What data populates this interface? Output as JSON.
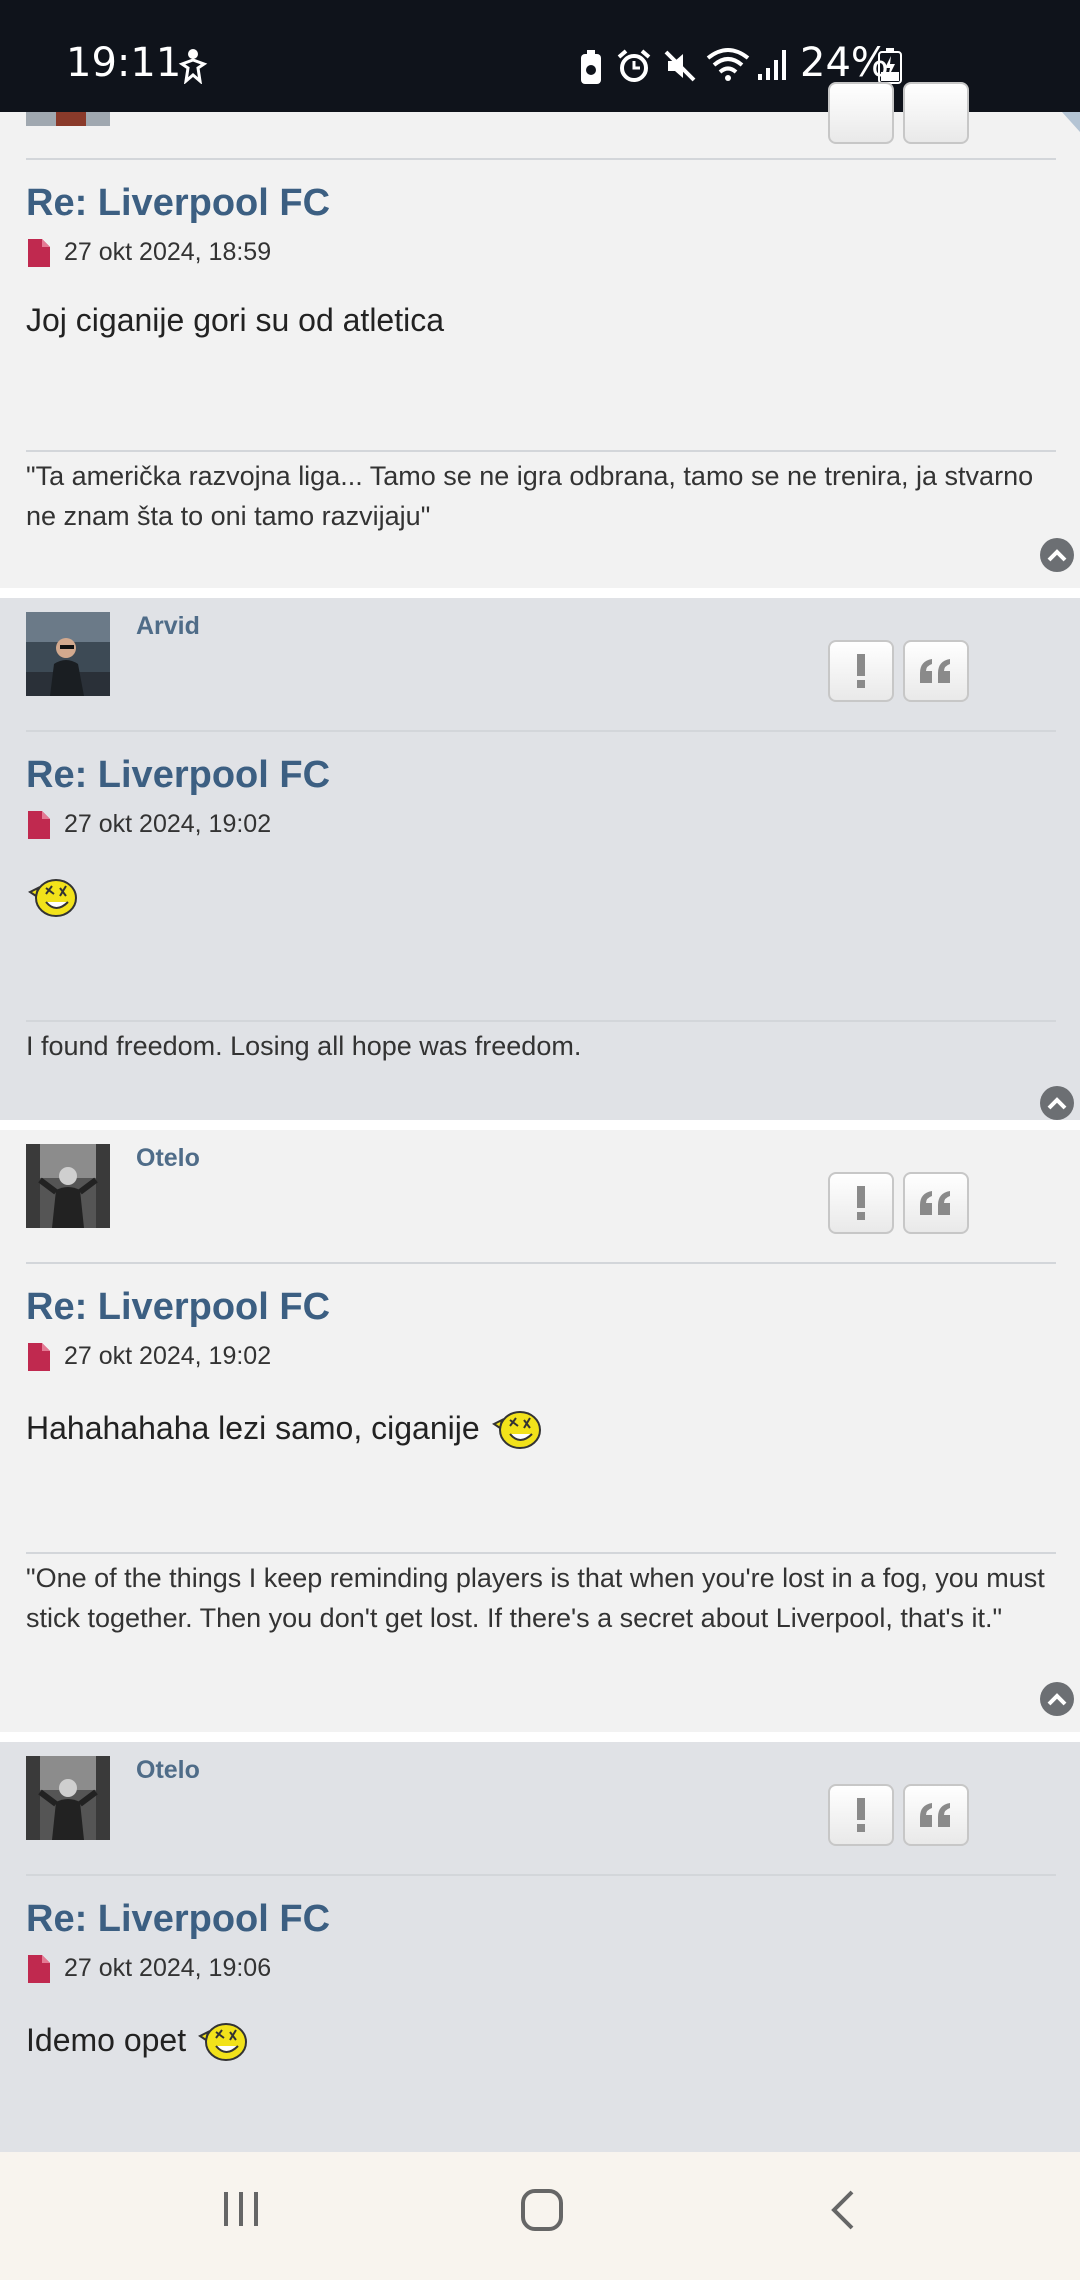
{
  "status_bar": {
    "time": "19:11",
    "battery": "24%"
  },
  "posts": [
    {
      "title": "Re: Liverpool FC",
      "date": "27 okt 2024, 18:59",
      "content": "Joj ciganije gori su od atletica",
      "signature": "\"Ta američka razvojna liga... Tamo se ne igra odbrana, tamo se ne trenira, ja stvarno ne znam šta to oni tamo razvijaju\""
    },
    {
      "username": "Arvid",
      "title": "Re: Liverpool FC",
      "date": "27 okt 2024, 19:02",
      "content": "",
      "signature": "I found freedom. Losing all hope was freedom."
    },
    {
      "username": "Otelo",
      "title": "Re: Liverpool FC",
      "date": "27 okt 2024, 19:02",
      "content": "Hahahahaha lezi samo, ciganije",
      "signature": "\"One of the things I keep reminding players is that when you're lost in a fog, you must stick together. Then you don't get lost. If there's a secret about Liverpool, that's it.\""
    },
    {
      "username": "Otelo",
      "title": "Re: Liverpool FC",
      "date": "27 okt 2024, 19:06",
      "content": "Idemo opet"
    }
  ],
  "icons": {
    "report": "exclamation-icon",
    "quote": "quote-icon",
    "post_marker": "document-icon",
    "back_to_top": "chevron-up-icon",
    "emoji": "laughing-emoji-icon"
  },
  "colors": {
    "title": "#3c5f82",
    "username": "#4f6c88",
    "post_light": "#f2f2f2",
    "post_dark": "#e0e2e6",
    "post_icon": "#c0294f"
  }
}
